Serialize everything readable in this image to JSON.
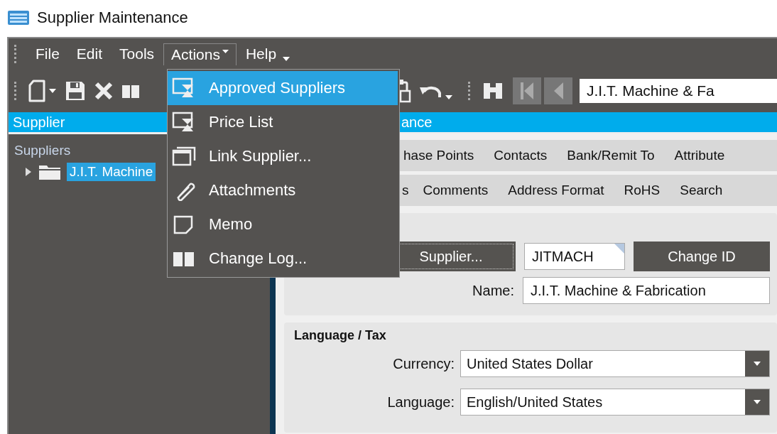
{
  "window": {
    "title": "Supplier Maintenance"
  },
  "menu_bar": [
    {
      "label": "File",
      "selected": false
    },
    {
      "label": "Edit",
      "selected": false
    },
    {
      "label": "Tools",
      "selected": false
    },
    {
      "label": "Actions",
      "selected": true
    },
    {
      "label": "Help",
      "selected": false
    }
  ],
  "actions_menu": [
    {
      "label": "Approved Suppliers",
      "selected": true
    },
    {
      "label": "Price List",
      "selected": false
    },
    {
      "label": "Link Supplier...",
      "selected": false
    },
    {
      "label": "Attachments",
      "selected": false
    },
    {
      "label": "Memo",
      "selected": false
    },
    {
      "label": "Change Log...",
      "selected": false
    }
  ],
  "toolbar": {
    "search_value": "J.I.T. Machine & Fa"
  },
  "left_panel": {
    "header": "Supplier",
    "tree": {
      "label": "Suppliers",
      "children": [
        {
          "label": "J.I.T. Machine",
          "selected": true,
          "expanded": false
        }
      ]
    }
  },
  "right_panel": {
    "header": "ance",
    "tabs_row_1": [
      "hase Points",
      "Contacts",
      "Bank/Remit To",
      "Attribute"
    ],
    "tabs_row_2": [
      "s",
      "Comments",
      "Address Format",
      "RoHS",
      "Search"
    ]
  },
  "form": {
    "supplier_button": "Supplier...",
    "supplier_id": "JITMACH",
    "change_id_button": "Change ID",
    "name_label": "Name:",
    "name": "J.I.T. Machine & Fabrication"
  },
  "language_tax": {
    "title": "Language / Tax",
    "fields": [
      {
        "label": "Currency:",
        "value": "United States Dollar"
      },
      {
        "label": "Language:",
        "value": "English/United States"
      }
    ]
  }
}
